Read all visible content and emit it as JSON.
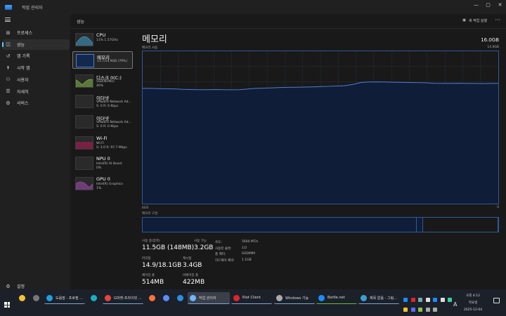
{
  "window": {
    "title": "작업 관리자",
    "controls": [
      "—",
      "▢",
      "✕"
    ]
  },
  "sidebar": {
    "items": [
      {
        "label": "프로세스",
        "icon": "grid-icon",
        "glyph": "⊞"
      },
      {
        "label": "성능",
        "icon": "performance-icon",
        "glyph": "◫",
        "active": true
      },
      {
        "label": "앱 기록",
        "icon": "history-icon",
        "glyph": "↺"
      },
      {
        "label": "시작 앱",
        "icon": "startup-icon",
        "glyph": "↟"
      },
      {
        "label": "사용자",
        "icon": "users-icon",
        "glyph": "⚇"
      },
      {
        "label": "자세히",
        "icon": "details-icon",
        "glyph": "☰"
      },
      {
        "label": "서비스",
        "icon": "services-icon",
        "glyph": "⚙"
      }
    ],
    "settings": {
      "label": "설정",
      "icon": "gear-icon",
      "glyph": "⚙"
    }
  },
  "header": {
    "section": "성능",
    "new_task": "새 작업 실행",
    "more": "···"
  },
  "perf_list": [
    {
      "name": "CPU",
      "sub1": "11% 1.57GHz",
      "sub2": "",
      "color": "#3fa9d6"
    },
    {
      "name": "메모리",
      "sub1": "11.7/14.9GB (79%)",
      "sub2": "",
      "color": "#4a7fd4",
      "active": true
    },
    {
      "name": "디스크 0(C:)",
      "sub1": "SSD(NVMe)",
      "sub2": "40%",
      "color": "#8bc34a"
    },
    {
      "name": "이더넷",
      "sub1": "VMware Network Ad...",
      "sub2": "S: 0 R: 0 Kbps",
      "color": ""
    },
    {
      "name": "이더넷",
      "sub1": "VMware Network Ad...",
      "sub2": "S: 0 R: 0 Kbps",
      "color": ""
    },
    {
      "name": "Wi-Fi",
      "sub1": "Wi-Fi",
      "sub2": "S: 3.0 R: 97.7 Mbps",
      "color": "#c2185b"
    },
    {
      "name": "NPU 0",
      "sub1": "Intel(R) AI Boost",
      "sub2": "0%",
      "color": ""
    },
    {
      "name": "GPU 0",
      "sub1": "Intel(R) Graphics",
      "sub2": "1%",
      "color": "#b04fc4"
    }
  ],
  "memory": {
    "title": "메모리",
    "total": "16.0GB",
    "usage_label": "메모리 사용",
    "usage_max": "14.9GB",
    "time_left": "60초",
    "time_right": "0",
    "composition_label": "메모리 구성",
    "composition": {
      "in_use_pct": 77,
      "modified_pct": 1.8,
      "standby_pct": 21.2
    },
    "usage_history_pct": [
      75.7,
      75.6,
      75.5,
      75.4,
      75.3,
      75.0,
      74.9,
      74.8,
      74.8,
      74.9,
      74.8,
      74.7,
      74.8,
      75.2,
      75.6,
      75.8,
      76.0,
      76.2,
      76.3,
      76.4,
      76.5,
      76.6,
      76.8,
      77.0,
      77.2,
      77.4,
      78.2,
      79.5,
      79.8,
      79.9,
      79.8,
      79.7,
      79.6,
      79.5,
      79.4,
      79.3,
      79.0,
      78.9,
      78.9,
      79.0,
      78.9,
      78.9,
      78.8,
      78.9,
      78.9
    ],
    "stats": [
      {
        "label": "사용 중(압축)",
        "value": "11.5GB (148MB)"
      },
      {
        "label": "사용 가능",
        "value": "3.2GB"
      },
      {
        "label": "커밋됨",
        "value": "14.9/18.1GB"
      },
      {
        "label": "캐시됨",
        "value": "3.4GB"
      },
      {
        "label": "페이징 풀",
        "value": "514MB"
      },
      {
        "label": "비페이징 풀",
        "value": "422MB"
      }
    ],
    "details": [
      {
        "k": "속도:",
        "v": "5600 MT/s"
      },
      {
        "k": "사용된 슬롯:",
        "v": "1/2"
      },
      {
        "k": "폼 팩터:",
        "v": "SODIMM"
      },
      {
        "k": "하드웨어 예약:",
        "v": "1.1GB"
      }
    ]
  },
  "taskbar": {
    "apps": [
      {
        "label": "",
        "icon": "file-explorer-icon",
        "color": "#f4c430"
      },
      {
        "label": "",
        "icon": "terminal-icon",
        "color": "#777"
      },
      {
        "label": "도움말 - 프로필 ...",
        "icon": "edge-icon",
        "color": "#1fa0e0"
      },
      {
        "label": "",
        "icon": "app-icon",
        "color": "#1ab0c0"
      },
      {
        "label": "G마켓-프라이빗 ...",
        "icon": "chrome-icon",
        "color": "#e8453c"
      },
      {
        "label": "",
        "icon": "firefox-icon",
        "color": "#ff7139"
      },
      {
        "label": "",
        "icon": "a-app-icon",
        "color": "#5b8cff"
      },
      {
        "label": "",
        "icon": "vscode-icon",
        "color": "#2a8fe0"
      },
      {
        "label": "작업 관리자",
        "icon": "task-manager-icon",
        "color": "#6fb6ff"
      },
      {
        "label": "Riot Client",
        "icon": "riot-icon",
        "color": "#e0242c"
      },
      {
        "label": "Windows 기능",
        "icon": "windows-features-icon",
        "color": "#aaa"
      },
      {
        "label": "Battle.net",
        "icon": "battlenet-icon",
        "color": "#1a8cff"
      },
      {
        "label": "제목 없음 - 그림...",
        "icon": "paint-icon",
        "color": "#3aa0d0"
      }
    ],
    "clock": {
      "time": "오후 4:12",
      "day": "목요일",
      "date": "2025-12-04"
    },
    "ime": "A"
  }
}
